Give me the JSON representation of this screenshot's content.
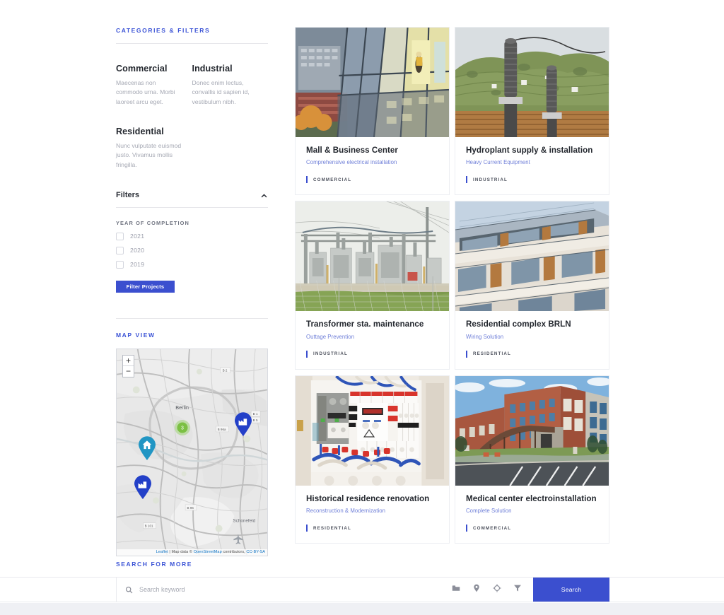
{
  "sidebar": {
    "categories_eyebrow": "CATEGORIES & FILTERS",
    "categories": [
      {
        "title": "Commercial",
        "desc": "Maecenas non commodo urna. Morbi laoreet arcu eget."
      },
      {
        "title": "Industrial",
        "desc": "Donec enim lectus, convallis id sapien id, vestibulum nibh."
      },
      {
        "title": "Residential",
        "desc": "Nunc vulputate euismod justo. Vivamus mollis fringilla."
      }
    ],
    "filters": {
      "header_label": "Filters",
      "collapse_icon": "chevron-up-icon",
      "group_label": "YEAR OF COMPLETION",
      "options": [
        {
          "label": "2021",
          "checked": false
        },
        {
          "label": "2020",
          "checked": false
        },
        {
          "label": "2019",
          "checked": false
        }
      ],
      "apply_button": "Filter Projects"
    },
    "map": {
      "eyebrow": "MAP VIEW",
      "zoom_in": "+",
      "zoom_out": "−",
      "city_label": "Berlin",
      "cluster_count": "3",
      "road_labels": [
        "B 2",
        "B 1",
        "B 5",
        "B 96a",
        "B 96",
        "B 101"
      ],
      "place_labels": [
        "Berlin",
        "Schonefeld"
      ],
      "markers": [
        {
          "type": "cluster",
          "label": "3",
          "color": "#7bc043"
        },
        {
          "type": "residential",
          "icon": "home-icon",
          "color": "#2196c4"
        },
        {
          "type": "industrial",
          "icon": "factory-icon",
          "color": "#2340c8"
        },
        {
          "type": "industrial",
          "icon": "factory-icon",
          "color": "#2340c8"
        }
      ],
      "attribution_prefix": "Leaflet",
      "attribution_mid": " | Map data © ",
      "attribution_osm": "OpenStreetMap",
      "attribution_suffix": " contributors, ",
      "attribution_license": "CC-BY-SA"
    }
  },
  "projects": [
    {
      "title": "Mall & Business Center",
      "subtitle": "Comprehensive electrical installation",
      "tag": "COMMERCIAL",
      "image_alt": "glass-facade-office-building"
    },
    {
      "title": "Hydroplant supply & installation",
      "subtitle": "Heavy Current Equipment",
      "tag": "INDUSTRIAL",
      "image_alt": "high-voltage-insulators-on-hillside"
    },
    {
      "title": "Transformer sta. maintenance",
      "subtitle": "Outtage Prevention",
      "tag": "INDUSTRIAL",
      "image_alt": "electrical-substation-transformers"
    },
    {
      "title": "Residential complex BRLN",
      "subtitle": "Wiring Solution",
      "tag": "RESIDENTIAL",
      "image_alt": "modern-apartment-building-facade"
    },
    {
      "title": "Historical residence renovation",
      "subtitle": "Reconstruction & Modernization",
      "tag": "RESIDENTIAL",
      "image_alt": "electrical-distribution-panel-breakers"
    },
    {
      "title": "Medical center electroinstallation",
      "subtitle": "Complete Solution",
      "tag": "COMMERCIAL",
      "image_alt": "brick-medical-center-entrance"
    }
  ],
  "search": {
    "eyebrow": "SEARCH FOR MORE",
    "placeholder": "Search keyword",
    "value": "",
    "magnify_icon": "search-icon",
    "tool_icons": [
      "folder-icon",
      "map-pin-icon",
      "target-icon",
      "funnel-icon"
    ],
    "button_label": "Search"
  },
  "colors": {
    "accent": "#3b4fcf",
    "eyebrow": "#3b53d6",
    "subtitle": "#6f7fd8",
    "title": "#23272e",
    "muted": "#a6a9b4",
    "footer": "#eff0f4"
  }
}
